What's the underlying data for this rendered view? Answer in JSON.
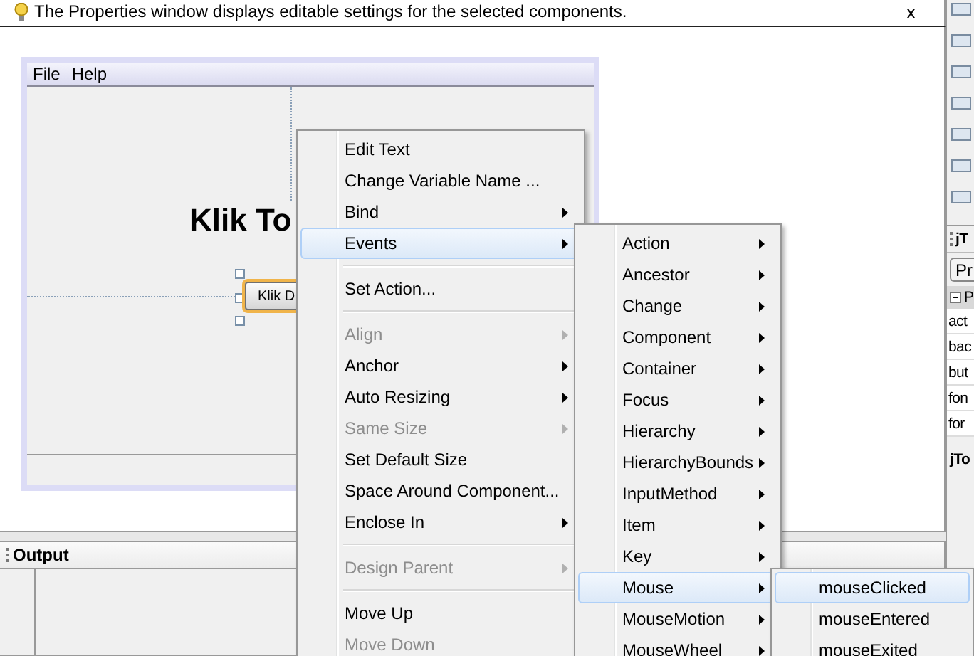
{
  "hint": {
    "text": "The Properties window displays editable settings for the selected components.",
    "close": "x"
  },
  "form": {
    "menu": [
      "File",
      "Help"
    ],
    "title": "Klik To",
    "button": "Klik D"
  },
  "context_menu": [
    {
      "kind": "item",
      "label": "Edit Text",
      "submenu": false,
      "disabled": false,
      "selected": false
    },
    {
      "kind": "item",
      "label": "Change Variable Name ...",
      "submenu": false,
      "disabled": false,
      "selected": false
    },
    {
      "kind": "item",
      "label": "Bind",
      "submenu": true,
      "disabled": false,
      "selected": false
    },
    {
      "kind": "item",
      "label": "Events",
      "submenu": true,
      "disabled": false,
      "selected": true
    },
    {
      "kind": "separator"
    },
    {
      "kind": "item",
      "label": "Set Action...",
      "submenu": false,
      "disabled": false,
      "selected": false
    },
    {
      "kind": "separator"
    },
    {
      "kind": "item",
      "label": "Align",
      "submenu": true,
      "disabled": true,
      "selected": false
    },
    {
      "kind": "item",
      "label": "Anchor",
      "submenu": true,
      "disabled": false,
      "selected": false
    },
    {
      "kind": "item",
      "label": "Auto Resizing",
      "submenu": true,
      "disabled": false,
      "selected": false
    },
    {
      "kind": "item",
      "label": "Same Size",
      "submenu": true,
      "disabled": true,
      "selected": false
    },
    {
      "kind": "item",
      "label": "Set Default Size",
      "submenu": false,
      "disabled": false,
      "selected": false
    },
    {
      "kind": "item",
      "label": "Space Around Component...",
      "submenu": false,
      "disabled": false,
      "selected": false
    },
    {
      "kind": "item",
      "label": "Enclose In",
      "submenu": true,
      "disabled": false,
      "selected": false
    },
    {
      "kind": "separator"
    },
    {
      "kind": "item",
      "label": "Design Parent",
      "submenu": true,
      "disabled": true,
      "selected": false
    },
    {
      "kind": "separator"
    },
    {
      "kind": "item",
      "label": "Move Up",
      "submenu": false,
      "disabled": false,
      "selected": false
    },
    {
      "kind": "item",
      "label": "Move Down",
      "submenu": false,
      "disabled": true,
      "selected": false
    }
  ],
  "events_submenu": [
    {
      "kind": "item",
      "label": "Action",
      "submenu": true,
      "disabled": false,
      "selected": false
    },
    {
      "kind": "item",
      "label": "Ancestor",
      "submenu": true,
      "disabled": false,
      "selected": false
    },
    {
      "kind": "item",
      "label": "Change",
      "submenu": true,
      "disabled": false,
      "selected": false
    },
    {
      "kind": "item",
      "label": "Component",
      "submenu": true,
      "disabled": false,
      "selected": false
    },
    {
      "kind": "item",
      "label": "Container",
      "submenu": true,
      "disabled": false,
      "selected": false
    },
    {
      "kind": "item",
      "label": "Focus",
      "submenu": true,
      "disabled": false,
      "selected": false
    },
    {
      "kind": "item",
      "label": "Hierarchy",
      "submenu": true,
      "disabled": false,
      "selected": false
    },
    {
      "kind": "item",
      "label": "HierarchyBounds",
      "submenu": true,
      "disabled": false,
      "selected": false
    },
    {
      "kind": "item",
      "label": "InputMethod",
      "submenu": true,
      "disabled": false,
      "selected": false
    },
    {
      "kind": "item",
      "label": "Item",
      "submenu": true,
      "disabled": false,
      "selected": false
    },
    {
      "kind": "item",
      "label": "Key",
      "submenu": true,
      "disabled": false,
      "selected": false
    },
    {
      "kind": "item",
      "label": "Mouse",
      "submenu": true,
      "disabled": false,
      "selected": true
    },
    {
      "kind": "item",
      "label": "MouseMotion",
      "submenu": true,
      "disabled": false,
      "selected": false
    },
    {
      "kind": "item",
      "label": "MouseWheel",
      "submenu": true,
      "disabled": false,
      "selected": false
    }
  ],
  "mouse_submenu": [
    {
      "kind": "item",
      "label": "mouseClicked",
      "submenu": false,
      "disabled": false,
      "selected": true
    },
    {
      "kind": "item",
      "label": "mouseEntered",
      "submenu": false,
      "disabled": false,
      "selected": false
    },
    {
      "kind": "item",
      "label": "mouseExited",
      "submenu": false,
      "disabled": false,
      "selected": false
    }
  ],
  "output": {
    "title": "Output"
  },
  "right_panel": {
    "header": "jT",
    "button": "Pr",
    "section": "P",
    "properties": [
      "act",
      "bac",
      "but",
      "fon",
      "for"
    ],
    "footer": "jTo"
  }
}
